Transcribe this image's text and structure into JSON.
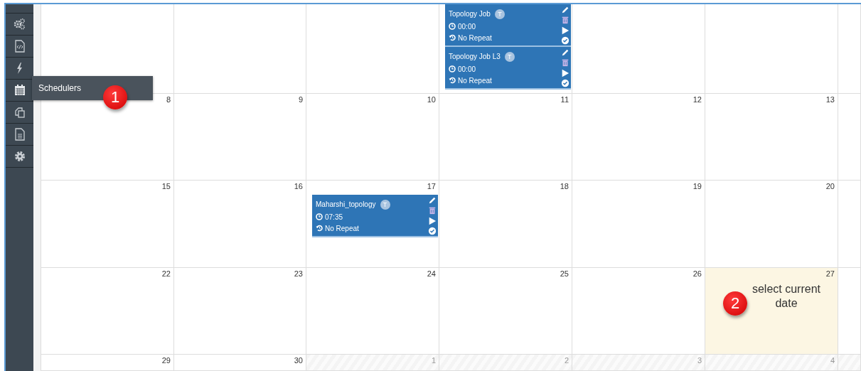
{
  "sidebar": {
    "items": [
      {
        "kind": "partial"
      },
      {
        "kind": "gears"
      },
      {
        "kind": "code-file"
      },
      {
        "kind": "bolt"
      },
      {
        "kind": "calendar"
      },
      {
        "kind": "copy"
      },
      {
        "kind": "document"
      },
      {
        "kind": "cog"
      }
    ]
  },
  "tooltip": {
    "text": "Schedulers",
    "callout": "1"
  },
  "calendar": {
    "weeks": [
      {
        "days": [
          {
            "kind": "blank"
          },
          {
            "kind": "blank"
          },
          {
            "kind": "blank"
          },
          {
            "kind": "day",
            "events": [
              {
                "title": "Topology Job",
                "badge": "T",
                "time": "00:00",
                "repeat": "No Repeat"
              },
              {
                "title": "Topology Job L3",
                "badge": "T",
                "time": "00:00",
                "repeat": "No Repeat"
              }
            ]
          }
        ]
      },
      {
        "days": [
          {
            "number": "8"
          },
          {
            "number": "9"
          },
          {
            "number": "10"
          },
          {
            "number": "11"
          },
          {
            "number": "12"
          },
          {
            "number": "13"
          }
        ]
      },
      {
        "days": [
          {
            "number": "15"
          },
          {
            "number": "16"
          },
          {
            "number": "17",
            "events": [
              {
                "title": "Maharshi_topology",
                "badge": "T",
                "time": "07:35",
                "repeat": "No Repeat"
              }
            ]
          },
          {
            "number": "18"
          },
          {
            "number": "19"
          },
          {
            "number": "20"
          }
        ]
      },
      {
        "days": [
          {
            "number": "22"
          },
          {
            "number": "23"
          },
          {
            "number": "24"
          },
          {
            "number": "25"
          },
          {
            "number": "26"
          },
          {
            "number": "27",
            "today": true,
            "callout": {
              "number": "2",
              "text": "select current date"
            }
          }
        ]
      },
      {
        "days": [
          {
            "number": "29"
          },
          {
            "number": "30"
          },
          {
            "number": "1",
            "muted": true
          },
          {
            "number": "2",
            "muted": true
          },
          {
            "number": "3",
            "muted": true
          },
          {
            "number": "4",
            "muted": true
          },
          {
            "muted": true
          }
        ]
      }
    ]
  }
}
